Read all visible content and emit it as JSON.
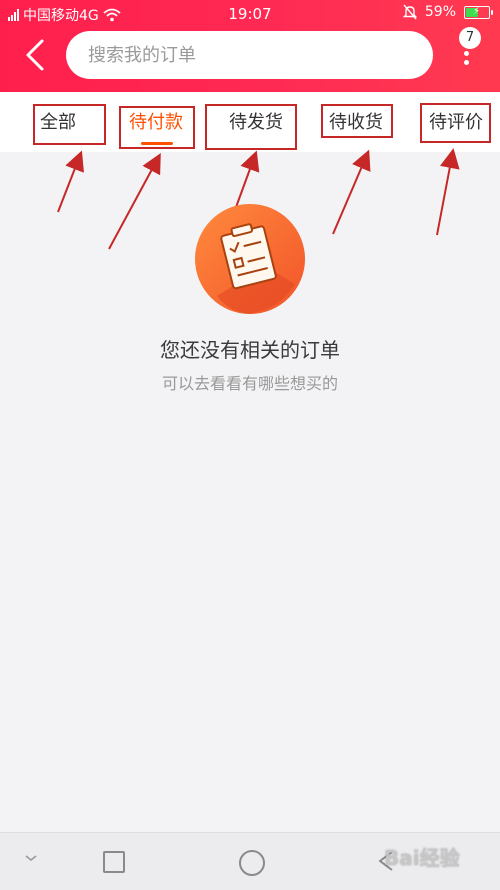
{
  "status_bar": {
    "carrier": "中国移动4G",
    "time": "19:07",
    "battery_percent": "59%",
    "battery_level": 0.59
  },
  "header": {
    "search": {
      "placeholder": "搜索我的订单",
      "value": ""
    },
    "badge_count": "7",
    "icons": {
      "back": "back-chevron-icon",
      "more": "more-vertical-icon"
    },
    "color": "#ff2350"
  },
  "tabs": [
    {
      "label": "全部",
      "active": false
    },
    {
      "label": "待付款",
      "active": true
    },
    {
      "label": "待发货",
      "active": false
    },
    {
      "label": "待收货",
      "active": false
    },
    {
      "label": "待评价",
      "active": false
    }
  ],
  "accent_color": "#ff5000",
  "annotation_color": "#c62828",
  "empty_state": {
    "title": "您还没有相关的订单",
    "subtitle": "可以去看看有哪些想买的",
    "icon": "empty-orders-illustration"
  },
  "nav_bar": {
    "icons": [
      "hide-keyboard-icon",
      "recent-apps-icon",
      "home-icon",
      "back-icon"
    ]
  },
  "watermark": {
    "text": "Bai经验"
  }
}
